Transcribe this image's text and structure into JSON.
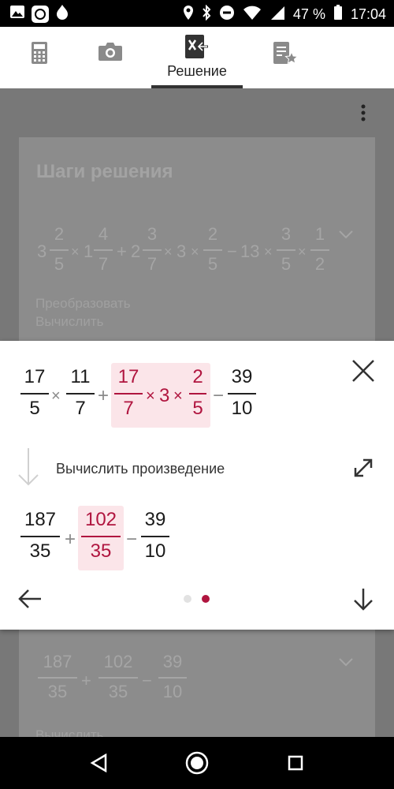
{
  "status_bar": {
    "battery": "47 %",
    "time": "17:04"
  },
  "tabs": {
    "active_label": "Решение"
  },
  "background": {
    "title": "Шаги решения",
    "expression1": {
      "mixed": [
        {
          "whole": "3",
          "num": "2",
          "den": "5"
        },
        {
          "whole": "1",
          "num": "4",
          "den": "7"
        },
        {
          "whole": "2",
          "num": "3",
          "den": "7"
        },
        {
          "whole": "3",
          "num": "2",
          "den": "5"
        },
        {
          "whole": "13",
          "num": "3",
          "den": "5"
        },
        {
          "whole": "",
          "num": "1",
          "den": "2"
        }
      ],
      "ops": [
        "×",
        "+",
        "×",
        "×",
        "−",
        "×",
        "×"
      ]
    },
    "link_transform": "Преобразовать",
    "link_compute": "Вычислить",
    "expression2": {
      "terms": [
        {
          "num": "187",
          "den": "35"
        },
        {
          "num": "102",
          "den": "35"
        },
        {
          "num": "39",
          "den": "10"
        }
      ],
      "ops": [
        "+",
        "−"
      ]
    },
    "link_cut": "Вычислить"
  },
  "modal": {
    "expr_top": {
      "f1": {
        "num": "17",
        "den": "5"
      },
      "f2": {
        "num": "11",
        "den": "7"
      },
      "f3": {
        "num": "17",
        "den": "7"
      },
      "mid": "3",
      "f4": {
        "num": "2",
        "den": "5"
      },
      "f5": {
        "num": "39",
        "den": "10"
      },
      "op_mul": "×",
      "op_add": "+",
      "op_sub": "−"
    },
    "step_label": "Вычислить произведение",
    "expr_bottom": {
      "f1": {
        "num": "187",
        "den": "35"
      },
      "f2": {
        "num": "102",
        "den": "35"
      },
      "f3": {
        "num": "39",
        "den": "10"
      },
      "op_add": "+",
      "op_sub": "−"
    }
  },
  "colors": {
    "accent": "#b0153f",
    "highlight": "#fbe5e9",
    "active_tab": "#333333"
  },
  "icons": [
    "calculator-icon",
    "camera-icon",
    "solution-icon",
    "bookmark-star-icon",
    "more-vert-icon",
    "close-icon",
    "expand-icon",
    "arrow-back-icon",
    "arrow-down-icon",
    "step-arrow-icon",
    "nav-back-icon",
    "nav-home-icon",
    "nav-recents-icon"
  ]
}
